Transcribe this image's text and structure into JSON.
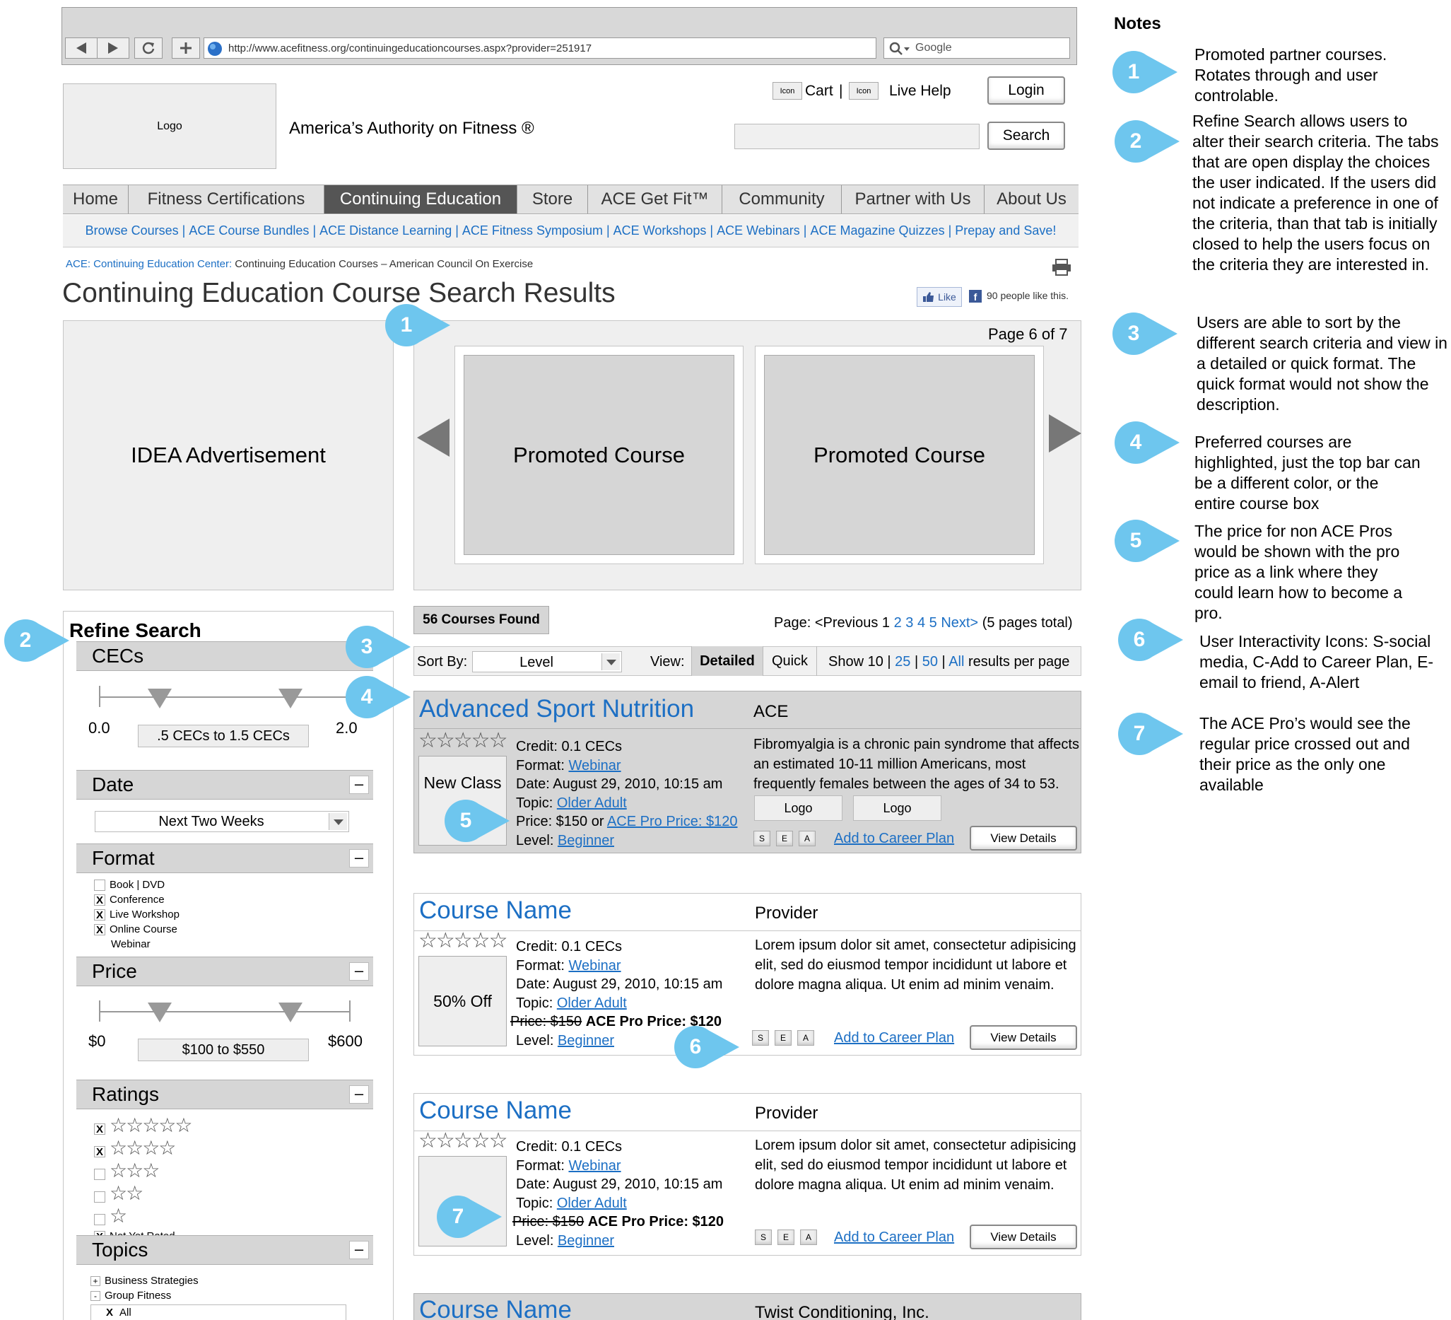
{
  "browser": {
    "url": "http://www.acefitness.org/continuingeducationcourses.aspx?provider=251917",
    "search_placeholder": "Google"
  },
  "header": {
    "logo": "Logo",
    "tagline": "America’s Authority on Fitness ®",
    "icon_label": "Icon",
    "cart": "Cart",
    "sep": "|",
    "live_help": "Live Help",
    "login": "Login",
    "search_button": "Search"
  },
  "nav": {
    "items": [
      "Home",
      "Fitness Certifications",
      "Continuing Education",
      "Store",
      "ACE Get Fit™",
      "Community",
      "Partner with Us",
      "About Us"
    ],
    "active": "Continuing Education"
  },
  "subnav": [
    "Browse Courses",
    "ACE Course Bundles",
    "ACE Distance Learning",
    "ACE Fitness Symposium",
    "ACE Workshops",
    "ACE Webinars",
    "ACE Magazine Quizzes",
    "Prepay and Save!"
  ],
  "breadcrumb": {
    "link": "ACE: Continuing Education Center:",
    "rest": " Continuing Education Courses – American Council On Exercise"
  },
  "page_title": "Continuing Education Course Search Results",
  "social": {
    "like": "Like",
    "count": "90 people like this."
  },
  "advert": "IDEA Advertisement",
  "carousel": {
    "page": "Page 6 of 7",
    "items": [
      "Promoted Course",
      "Promoted Course"
    ]
  },
  "refine": {
    "title": "Refine Search",
    "cecs": {
      "label": "CECs",
      "min": "0.0",
      "max": "2.0",
      "range": ".5 CECs to 1.5 CECs"
    },
    "date": {
      "label": "Date",
      "value": "Next Two Weeks"
    },
    "format": {
      "label": "Format",
      "options": [
        {
          "label": "Book | DVD",
          "checked": false
        },
        {
          "label": "Conference",
          "checked": true
        },
        {
          "label": "Live Workshop",
          "checked": true
        },
        {
          "label": "Online Course",
          "checked": true
        },
        {
          "label": "Webinar",
          "checked": false
        }
      ]
    },
    "price": {
      "label": "Price",
      "min": "$0",
      "max": "$600",
      "range": "$100 to $550"
    },
    "ratings": {
      "label": "Ratings",
      "options": [
        {
          "stars": "☆☆☆☆☆",
          "checked": true
        },
        {
          "stars": "☆☆☆☆",
          "checked": true
        },
        {
          "stars": "☆☆☆",
          "checked": false
        },
        {
          "stars": "☆☆",
          "checked": false
        },
        {
          "stars": "☆",
          "checked": false
        }
      ],
      "not_rated": "Not Yet Rated"
    },
    "topics": {
      "label": "Topics",
      "items": [
        "Business Strategies",
        "Group Fitness"
      ],
      "all": "All"
    },
    "check_mark": "X",
    "collapse": "–",
    "plus": "+",
    "minus_small": "-"
  },
  "results": {
    "found": "56 Courses Found",
    "pager": {
      "prefix": "Page: <Previous 1",
      "pages": [
        "2",
        "3",
        "4",
        "5"
      ],
      "next": "Next>",
      "suffix": "(5 pages total)"
    },
    "sort_label": "Sort By:",
    "sort_value": "Level",
    "view_label": "View:",
    "view_detailed": "Detailed",
    "view_quick": "Quick",
    "show": {
      "prefix": "Show 10 |",
      "n25": "25",
      "sep1": "|",
      "n50": "50",
      "sep2": "|",
      "all": "All",
      "suffix": "results per page"
    }
  },
  "courses": [
    {
      "title": "Advanced Sport Nutrition",
      "provider": "ACE",
      "stars": "☆☆☆☆☆",
      "badge": "New Class",
      "credit": "Credit: 0.1 CECs",
      "format_label": "Format:",
      "format": "Webinar",
      "date": "Date: August 29, 2010, 10:15 am",
      "topic_label": "Topic:",
      "topic": "Older Adult",
      "price_prefix": "Price: $150 or",
      "pro_price": "ACE Pro Price: $120",
      "level_label": "Level:",
      "level": "Beginner",
      "description": "Fibromyalgia is a chronic pain syndrome that affects an estimated 10-11 million Americans, most frequently females between the ages of 34 to 53.",
      "logos": [
        "Logo",
        "Logo"
      ],
      "icons": [
        "S",
        "E",
        "A"
      ],
      "career": "Add to Career Plan",
      "details": "View Details"
    },
    {
      "title": "Course Name",
      "provider": "Provider",
      "stars": "☆☆☆☆☆",
      "badge": "50% Off",
      "credit": "Credit: 0.1 CECs",
      "format_label": "Format:",
      "format": "Webinar",
      "date": "Date: August 29, 2010, 10:15 am",
      "topic_label": "Topic:",
      "topic": "Older Adult",
      "old_price": "Price: $150",
      "pro_price": "ACE Pro Price: $120",
      "level_label": "Level:",
      "level": "Beginner",
      "description": "Lorem ipsum dolor sit amet, consectetur adipisicing elit, sed do eiusmod tempor incididunt ut labore et dolore magna aliqua. Ut enim ad minim venaim.",
      "icons": [
        "S",
        "E",
        "A"
      ],
      "career": "Add to Career Plan",
      "details": "View Details"
    },
    {
      "title": "Course Name",
      "provider": "Provider",
      "stars": "☆☆☆☆☆",
      "credit": "Credit: 0.1 CECs",
      "format_label": "Format:",
      "format": "Webinar",
      "date": "Date: August 29, 2010, 10:15 am",
      "topic_label": "Topic:",
      "topic": "Older Adult",
      "old_price": "Price: $150",
      "pro_price": "ACE Pro Price: $120",
      "level_label": "Level:",
      "level": "Beginner",
      "description": "Lorem ipsum dolor sit amet, consectetur adipisicing elit, sed do eiusmod tempor incididunt ut labore et dolore magna aliqua. Ut enim ad minim venaim.",
      "icons": [
        "S",
        "E",
        "A"
      ],
      "career": "Add to Career Plan",
      "details": "View Details"
    },
    {
      "title": "Course Name",
      "provider": "Twist Conditioning, Inc."
    }
  ],
  "callouts": [
    "1",
    "2",
    "3",
    "4",
    "5",
    "6",
    "7"
  ],
  "notes": {
    "title": "Notes",
    "items": [
      {
        "num": "1",
        "text": "Promoted partner courses. Rotates through and user controlable."
      },
      {
        "num": "2",
        "text": "Refine Search allows users to alter their search criteria. The tabs that are open display the choices the user indicated. If the users did not indicate a preference in one of the criteria, than that tab is initially closed to help the users focus on the criteria they are interested in."
      },
      {
        "num": "3",
        "text": "Users are able to sort by the different search criteria and view in a detailed or quick format. The quick format would not show the description."
      },
      {
        "num": "4",
        "text": "Preferred courses are highlighted, just the top bar can be a different color, or the entire course box"
      },
      {
        "num": "5",
        "text": "The price for non ACE Pros would be shown with the pro price as a link where they could learn how to become a pro."
      },
      {
        "num": "6",
        "text": "User Interactivity Icons: S-social media, C-Add to Career Plan, E-email to friend, A-Alert"
      },
      {
        "num": "7",
        "text": "The ACE Pro’s would see the regular price crossed out and their price as the only one available"
      }
    ]
  },
  "colors": {
    "callout": "#6ec6ee",
    "link": "#1c6fc4",
    "nav_active": "#555555",
    "highlight": "#d6d6d6"
  }
}
